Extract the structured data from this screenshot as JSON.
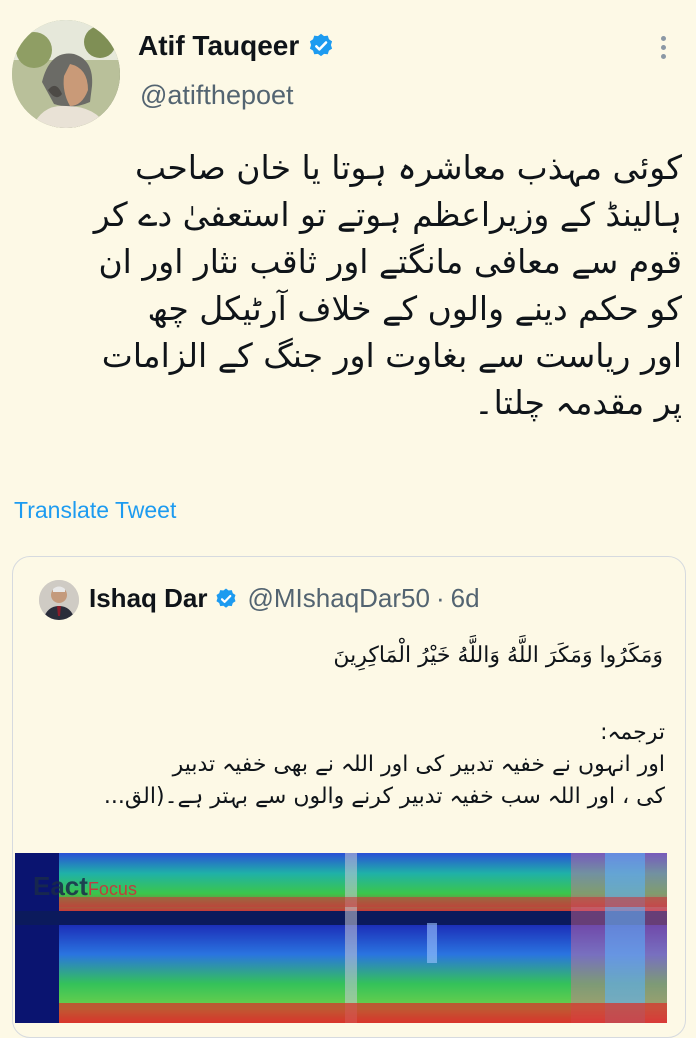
{
  "author": {
    "name": "Atif Tauqeer",
    "handle": "@atifthepoet",
    "avatar_icon": "user-photo"
  },
  "tweet": {
    "text_lines": [
      "کوئی مہذب معاشرہ ہوتا یا خان صاحب",
      "ہالینڈ کے وزیراعظم ہوتے تو استعفیٰ دے کر",
      "قوم سے معافی مانگتے اور ثاقب نثار اور ان",
      "کو حکم دینے والوں کے خلاف آرٹیکل چھ",
      "اور ریاست سے بغاوت اور جنگ کے الزامات",
      "پر مقدمہ چلتا۔"
    ],
    "translate_label": "Translate Tweet"
  },
  "quoted": {
    "name": "Ishaq Dar",
    "handle": "@MIshaqDar50",
    "separator": "·",
    "time": "6d",
    "arabic": "وَمَكَرُوا وَمَكَرَ اللَّهُ وَاللَّهُ خَيْرُ الْمَاكِرِينَ",
    "text_lines": [
      "ترجمہ:",
      "اور انہوں نے خفیہ تدبیر کی اور اللہ نے بھی خفیہ تدبیر",
      "کی ، اور اللہ سب خفیہ تدبیر کرنے والوں سے بہتر ہے۔(الق..."
    ],
    "media_watermark_a": "Eact",
    "media_watermark_b": "Focus"
  },
  "colors": {
    "background": "#fdf9e6",
    "link": "#1d9bf0",
    "verified": "#1d9bf0",
    "secondary_text": "#536471"
  }
}
